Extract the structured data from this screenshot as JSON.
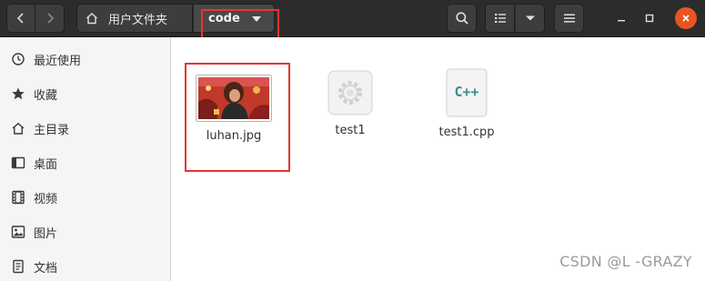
{
  "header": {
    "breadcrumb_home": "用户文件夹",
    "breadcrumb_current": "code"
  },
  "sidebar": {
    "items": [
      {
        "label": "最近使用",
        "icon": "clock-icon"
      },
      {
        "label": "收藏",
        "icon": "star-icon"
      },
      {
        "label": "主目录",
        "icon": "home-icon"
      },
      {
        "label": "桌面",
        "icon": "desktop-icon"
      },
      {
        "label": "视频",
        "icon": "video-icon"
      },
      {
        "label": "图片",
        "icon": "picture-icon"
      },
      {
        "label": "文档",
        "icon": "document-icon"
      }
    ]
  },
  "files": [
    {
      "name": "luhan.jpg",
      "icon": "image-thumbnail-icon"
    },
    {
      "name": "test1",
      "icon": "executable-gear-icon"
    },
    {
      "name": "test1.cpp",
      "icon": "cpp-source-icon",
      "badge": "C++"
    }
  ],
  "watermark": "CSDN @L -GRAZY",
  "colors": {
    "accent_close": "#e95420",
    "annotation": "#e8332e"
  }
}
